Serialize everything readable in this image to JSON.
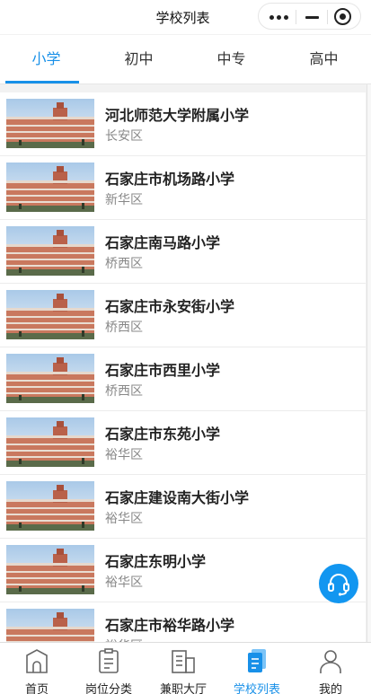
{
  "header": {
    "title": "学校列表",
    "capsule": {
      "more_icon": "more-dots-icon",
      "minimize_icon": "minimize-icon",
      "close_icon": "target-close-icon"
    }
  },
  "tabs": [
    {
      "label": "小学",
      "active": true
    },
    {
      "label": "初中",
      "active": false
    },
    {
      "label": "中专",
      "active": false
    },
    {
      "label": "高中",
      "active": false
    }
  ],
  "schools": [
    {
      "name": "河北师范大学附属小学",
      "district": "长安区"
    },
    {
      "name": "石家庄市机场路小学",
      "district": "新华区"
    },
    {
      "name": "石家庄南马路小学",
      "district": "桥西区"
    },
    {
      "name": "石家庄市永安街小学",
      "district": "桥西区"
    },
    {
      "name": "石家庄市西里小学",
      "district": "桥西区"
    },
    {
      "name": "石家庄市东苑小学",
      "district": "裕华区"
    },
    {
      "name": "石家庄建设南大街小学",
      "district": "裕华区"
    },
    {
      "name": "石家庄东明小学",
      "district": "裕华区"
    },
    {
      "name": "石家庄市裕华路小学",
      "district": "裕华区"
    }
  ],
  "fab": {
    "icon": "headset-service-icon"
  },
  "bottom_nav": [
    {
      "label": "首页",
      "icon": "home-icon",
      "active": false
    },
    {
      "label": "岗位分类",
      "icon": "clipboard-icon",
      "active": false
    },
    {
      "label": "兼职大厅",
      "icon": "building-icon",
      "active": false
    },
    {
      "label": "学校列表",
      "icon": "document-list-icon",
      "active": true
    },
    {
      "label": "我的",
      "icon": "person-icon",
      "active": false
    }
  ],
  "colors": {
    "accent": "#1890e8",
    "fab": "#1296f0",
    "text": "#222222",
    "subtext": "#888888"
  }
}
